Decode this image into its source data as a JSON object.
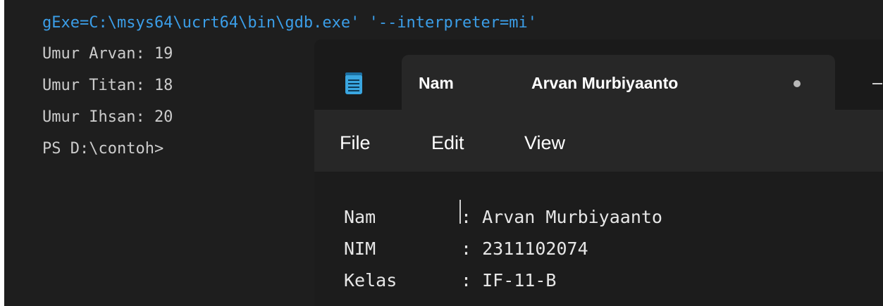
{
  "terminal": {
    "command_line": "gExe=C:\\msys64\\ucrt64\\bin\\gdb.exe' '--interpreter=mi'",
    "output_lines": [
      "Umur Arvan: 19",
      "Umur Titan: 18",
      "Umur Ihsan: 20",
      "PS D:\\contoh>"
    ],
    "colors": {
      "background": "#1e1e1e",
      "command": "#3b9ee8",
      "text": "#cccccc"
    }
  },
  "notepad": {
    "tab_title_field": "Nam",
    "tab_title_value": "Arvan Murbiyaanto",
    "menu": [
      "File",
      "Edit",
      "View"
    ],
    "editor_lines": [
      {
        "label": "Nam",
        "value": ": Arvan Murbiyaanto"
      },
      {
        "label": "NIM",
        "value": ": 2311102074"
      },
      {
        "label": "Kelas",
        "value": ": IF-11-B"
      }
    ],
    "icons": {
      "app": "notepad-icon",
      "modified": "unsaved-dot-icon"
    },
    "colors": {
      "icon": "#3aa6e0",
      "background": "#202020"
    }
  }
}
